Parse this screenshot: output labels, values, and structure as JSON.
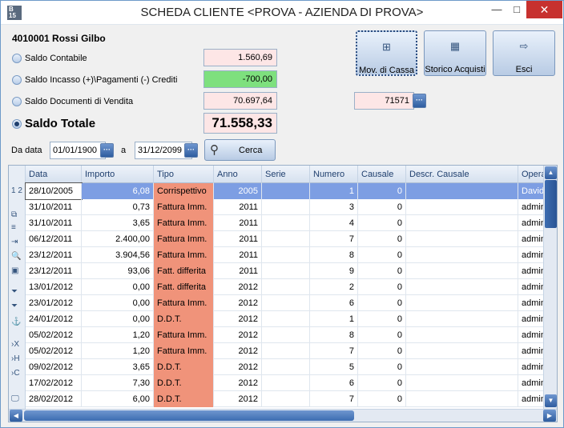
{
  "window": {
    "title": "SCHEDA CLIENTE <PROVA - AZIENDA DI PROVA>",
    "app_icon_text": "B\n15",
    "minimize": "—",
    "maximize": "□",
    "close": "✕"
  },
  "customer": {
    "code_name": "4010001 Rossi Gilbo"
  },
  "balances": [
    {
      "label": "Saldo Contabile",
      "value": "1.560,69",
      "color": "#fde6e6"
    },
    {
      "label": "Saldo Incasso (+)\\Pagamenti (-) Crediti",
      "value": "-700,00",
      "color": "#7ee07e"
    },
    {
      "label": "Saldo Documenti di Vendita",
      "value": "70.697,64",
      "color": "#fde6e6"
    }
  ],
  "total": {
    "label": "Saldo Totale",
    "value": "71.558,33"
  },
  "doc_ref": {
    "value": "71571",
    "button": "···"
  },
  "buttons": {
    "mov_cassa": "Mov. di Cassa",
    "storico": "Storico Acquisti",
    "esci": "Esci",
    "cerca": "Cerca",
    "dots": "···"
  },
  "filter": {
    "from_label": "Da data",
    "from_value": "01/01/1900",
    "to_label": "a",
    "to_value": "31/12/2099"
  },
  "grid": {
    "columns": [
      "Data",
      "Importo",
      "Tipo",
      "Anno",
      "Serie",
      "Numero",
      "Causale",
      "Descr. Causale",
      "Operatore"
    ],
    "rows": [
      {
        "data": "28/10/2005",
        "importo": "6,08",
        "tipo": "Corrispettivo",
        "anno": "2005",
        "serie": "",
        "numero": "1",
        "causale": "0",
        "descr": "",
        "operatore": "Davide"
      },
      {
        "data": "31/10/2011",
        "importo": "0,73",
        "tipo": "Fattura Imm.",
        "anno": "2011",
        "serie": "",
        "numero": "3",
        "causale": "0",
        "descr": "",
        "operatore": "admin"
      },
      {
        "data": "31/10/2011",
        "importo": "3,65",
        "tipo": "Fattura Imm.",
        "anno": "2011",
        "serie": "",
        "numero": "4",
        "causale": "0",
        "descr": "",
        "operatore": "admin"
      },
      {
        "data": "06/12/2011",
        "importo": "2.400,00",
        "tipo": "Fattura Imm.",
        "anno": "2011",
        "serie": "",
        "numero": "7",
        "causale": "0",
        "descr": "",
        "operatore": "admin"
      },
      {
        "data": "23/12/2011",
        "importo": "3.904,56",
        "tipo": "Fattura Imm.",
        "anno": "2011",
        "serie": "",
        "numero": "8",
        "causale": "0",
        "descr": "",
        "operatore": "admin"
      },
      {
        "data": "23/12/2011",
        "importo": "93,06",
        "tipo": "Fatt. differita",
        "anno": "2011",
        "serie": "",
        "numero": "9",
        "causale": "0",
        "descr": "",
        "operatore": "admin"
      },
      {
        "data": "13/01/2012",
        "importo": "0,00",
        "tipo": "Fatt. differita",
        "anno": "2012",
        "serie": "",
        "numero": "2",
        "causale": "0",
        "descr": "",
        "operatore": "admin"
      },
      {
        "data": "23/01/2012",
        "importo": "0,00",
        "tipo": "Fattura Imm.",
        "anno": "2012",
        "serie": "",
        "numero": "6",
        "causale": "0",
        "descr": "",
        "operatore": "admin"
      },
      {
        "data": "24/01/2012",
        "importo": "0,00",
        "tipo": "D.D.T.",
        "anno": "2012",
        "serie": "",
        "numero": "1",
        "causale": "0",
        "descr": "",
        "operatore": "admin"
      },
      {
        "data": "05/02/2012",
        "importo": "1,20",
        "tipo": "Fattura Imm.",
        "anno": "2012",
        "serie": "",
        "numero": "8",
        "causale": "0",
        "descr": "",
        "operatore": "admin"
      },
      {
        "data": "05/02/2012",
        "importo": "1,20",
        "tipo": "Fattura Imm.",
        "anno": "2012",
        "serie": "",
        "numero": "7",
        "causale": "0",
        "descr": "",
        "operatore": "admin"
      },
      {
        "data": "09/02/2012",
        "importo": "3,65",
        "tipo": "D.D.T.",
        "anno": "2012",
        "serie": "",
        "numero": "5",
        "causale": "0",
        "descr": "",
        "operatore": "admin"
      },
      {
        "data": "17/02/2012",
        "importo": "7,30",
        "tipo": "D.D.T.",
        "anno": "2012",
        "serie": "",
        "numero": "6",
        "causale": "0",
        "descr": "",
        "operatore": "admin"
      },
      {
        "data": "28/02/2012",
        "importo": "6,00",
        "tipo": "D.D.T.",
        "anno": "2012",
        "serie": "",
        "numero": "7",
        "causale": "0",
        "descr": "",
        "operatore": "admin"
      }
    ],
    "rowbar_icons": [
      "1\n2",
      "⧉",
      "≡",
      "⇥",
      "🔍",
      "▣",
      "⏷",
      "⏷",
      "⚓",
      "›X",
      "›H",
      "›C",
      "🖵"
    ]
  },
  "colors": {
    "tipo_cell": "#f0937a",
    "selected_row": "#7d9ee3",
    "green_box": "#7ee07e",
    "pink_box": "#fde6e6"
  }
}
